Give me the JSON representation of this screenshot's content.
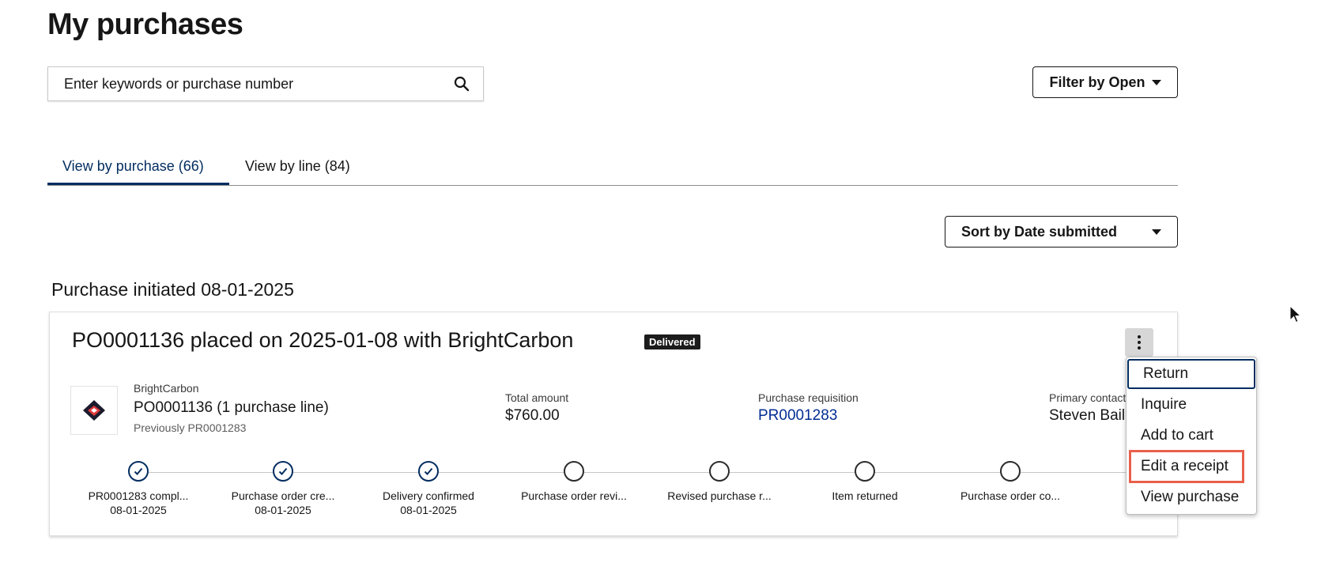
{
  "page": {
    "title": "My purchases"
  },
  "search": {
    "placeholder": "Enter keywords or purchase number",
    "icon": "search-icon"
  },
  "filter": {
    "label": "Filter by Open"
  },
  "tabs": [
    {
      "label": "View by purchase (66)",
      "active": true
    },
    {
      "label": "View by line (84)",
      "active": false
    }
  ],
  "sort": {
    "label": "Sort by Date submitted"
  },
  "section": {
    "heading": "Purchase initiated 08-01-2025"
  },
  "card": {
    "title": "PO0001136 placed on 2025-01-08 with BrightCarbon",
    "status": "Delivered",
    "vendor": {
      "name": "BrightCarbon",
      "po_lines": "PO0001136 (1 purchase line)",
      "previously": "Previously PR0001283"
    },
    "total": {
      "label": "Total amount",
      "value": "$760.00"
    },
    "requisition": {
      "label": "Purchase requisition",
      "value": "PR0001283"
    },
    "contact": {
      "label": "Primary contact",
      "value": "Steven Bailey"
    },
    "steps": [
      {
        "label": "PR0001283 compl...",
        "date": "08-01-2025",
        "done": true
      },
      {
        "label": "Purchase order cre...",
        "date": "08-01-2025",
        "done": true
      },
      {
        "label": "Delivery confirmed",
        "date": "08-01-2025",
        "done": true
      },
      {
        "label": "Purchase order revi...",
        "date": "",
        "done": false
      },
      {
        "label": "Revised purchase r...",
        "date": "",
        "done": false
      },
      {
        "label": "Item returned",
        "date": "",
        "done": false
      },
      {
        "label": "Purchase order co...",
        "date": "",
        "done": false
      }
    ]
  },
  "menu": {
    "items": [
      "Return",
      "Inquire",
      "Add to cart",
      "Edit a receipt",
      "View purchase"
    ],
    "highlighted": "Edit a receipt"
  },
  "colors": {
    "accent": "#032d60",
    "link": "#032d93",
    "highlight": "#e8604c",
    "badge": "#1c1c1c"
  }
}
